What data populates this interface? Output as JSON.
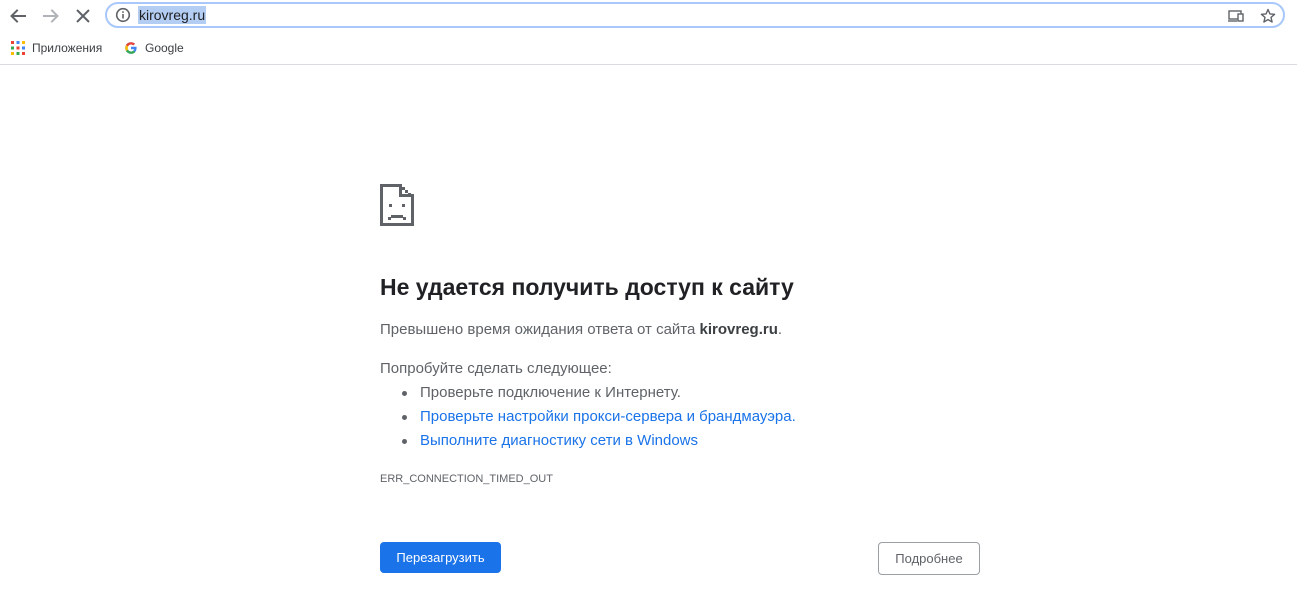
{
  "toolbar": {
    "back_icon": "arrow-left-icon",
    "forward_icon": "arrow-right-icon",
    "stop_icon": "close-icon",
    "url": "kirovreg.ru",
    "info_icon": "info-circle-icon",
    "cast_icon": "cast-icon",
    "bookmark_icon": "star-icon"
  },
  "bookmarks": {
    "items": [
      {
        "label": "Приложения",
        "icon": "apps-grid-icon"
      },
      {
        "label": "Google",
        "icon": "google-g-icon"
      }
    ]
  },
  "error": {
    "icon": "sad-page-icon",
    "title": "Не удается получить доступ к сайту",
    "summary_prefix": "Превышено время ожидания ответа от сайта ",
    "summary_host": "kirovreg.ru",
    "summary_suffix": ".",
    "try_label": "Попробуйте сделать следующее:",
    "suggestions": [
      {
        "text": "Проверьте подключение к Интернету.",
        "link": false
      },
      {
        "text": "Проверьте настройки прокси-сервера и брандмауэра.",
        "link": true
      },
      {
        "text": "Выполните диагностику сети в Windows",
        "link": true
      }
    ],
    "code": "ERR_CONNECTION_TIMED_OUT",
    "reload_label": "Перезагрузить",
    "details_label": "Подробнее"
  },
  "colors": {
    "primary": "#1a73e8",
    "text_secondary": "#5f6368",
    "title": "#202124"
  }
}
